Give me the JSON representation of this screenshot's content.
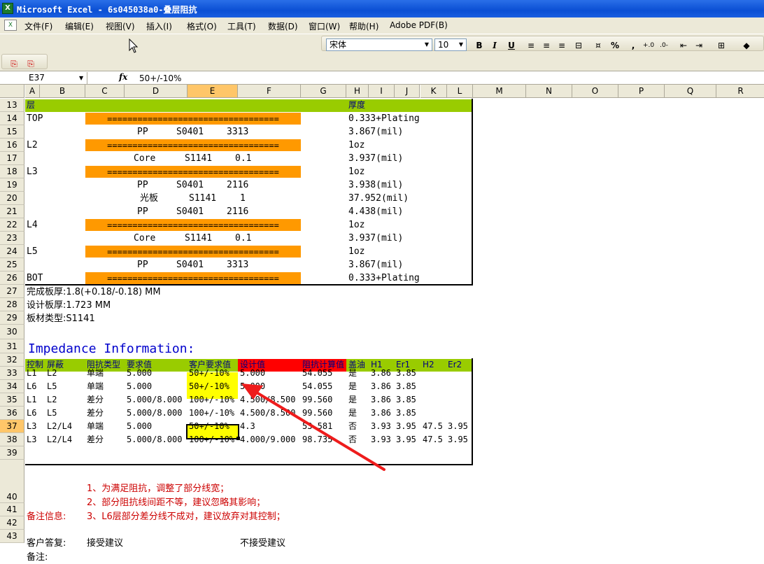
{
  "window": {
    "title": "Microsoft Excel - 6s045038a0-叠层阻抗",
    "app_icon": "excel-icon"
  },
  "menu": [
    "文件(F)",
    "编辑(E)",
    "视图(V)",
    "插入(I)",
    "格式(O)",
    "工具(T)",
    "数据(D)",
    "窗口(W)",
    "帮助(H)",
    "Adobe PDF(B)"
  ],
  "toolbar": {
    "font": "宋体",
    "size": "10",
    "bold": "B",
    "italic": "I",
    "underline": "U",
    "percent": "%",
    "comma": ","
  },
  "formula_bar": {
    "name_box": "E37",
    "fx": "fx",
    "value": "50+/-10%"
  },
  "columns": [
    "A",
    "B",
    "C",
    "D",
    "E",
    "F",
    "G",
    "H",
    "I",
    "J",
    "K",
    "L",
    "M",
    "N",
    "O",
    "P",
    "Q",
    "R"
  ],
  "selected_cell": {
    "column": "E",
    "row": "37"
  },
  "rows": [
    "13",
    "14",
    "15",
    "16",
    "17",
    "18",
    "19",
    "20",
    "21",
    "22",
    "23",
    "24",
    "25",
    "26",
    "27",
    "28",
    "29",
    "30",
    "31",
    "32",
    "33",
    "34",
    "35",
    "36",
    "37",
    "38",
    "39",
    "40",
    "41",
    "42",
    "43"
  ],
  "stackup": {
    "header": {
      "layer": "层",
      "thickness": "厚度"
    },
    "separator": "==================================",
    "r14": {
      "a": "TOP",
      "h": "0.333+Plating"
    },
    "r15": {
      "d1": "PP",
      "d2": "S0401",
      "d3": "3313",
      "h": "3.867(mil)"
    },
    "r16": {
      "a": "L2",
      "h": "1oz"
    },
    "r17": {
      "d1": "Core",
      "d2": "S1141",
      "d3": "0.1",
      "h": "3.937(mil)"
    },
    "r18": {
      "a": "L3",
      "h": "1oz"
    },
    "r19": {
      "d1": "PP",
      "d2": "S0401",
      "d3": "2116",
      "h": "3.938(mil)"
    },
    "r20": {
      "d1": "光板",
      "d2": "S1141",
      "d3": "1",
      "h": "37.952(mil)"
    },
    "r21": {
      "d1": "PP",
      "d2": "S0401",
      "d3": "2116",
      "h": "4.438(mil)"
    },
    "r22": {
      "a": "L4",
      "h": "1oz"
    },
    "r23": {
      "d1": "Core",
      "d2": "S1141",
      "d3": "0.1",
      "h": "3.937(mil)"
    },
    "r24": {
      "a": "L5",
      "h": "1oz"
    },
    "r25": {
      "d1": "PP",
      "d2": "S0401",
      "d3": "3313",
      "h": "3.867(mil)"
    },
    "r26": {
      "a": "BOT",
      "h": "0.333+Plating"
    }
  },
  "notes": {
    "r27": "完成板厚:1.8(+0.18/-0.18) MM",
    "r28": "设计板厚:1.723 MM",
    "r29": "板材类型:S1141"
  },
  "impedance": {
    "title": "Impedance Information:",
    "headers": {
      "ctrl": "控制",
      "shield": "屏蔽",
      "type": "阻抗类型",
      "req": "要求值",
      "cust": "客户要求值",
      "design": "设计值",
      "calc": "阻抗计算值",
      "oil": "盖油",
      "h1": "H1",
      "er1": "Er1",
      "h2": "H2",
      "er2": "Er2"
    },
    "rows": [
      {
        "ctrl": "L1",
        "shield": "L2",
        "type": "单端",
        "req": "5.000",
        "cust": "50+/-10%",
        "design": "5.000",
        "calc": "54.055",
        "oil": "是",
        "h1": "3.86",
        "er1": "3.85",
        "h2": "",
        "er2": ""
      },
      {
        "ctrl": "L6",
        "shield": "L5",
        "type": "单端",
        "req": "5.000",
        "cust": "50+/-10%",
        "design": "5.000",
        "calc": "54.055",
        "oil": "是",
        "h1": "3.86",
        "er1": "3.85",
        "h2": "",
        "er2": ""
      },
      {
        "ctrl": "L1",
        "shield": "L2",
        "type": "差分",
        "req": "5.000/8.000",
        "cust": "100+/-10%",
        "design": "4.500/8.500",
        "calc": "99.560",
        "oil": "是",
        "h1": "3.86",
        "er1": "3.85",
        "h2": "",
        "er2": ""
      },
      {
        "ctrl": "L6",
        "shield": "L5",
        "type": "差分",
        "req": "5.000/8.000",
        "cust": "100+/-10%",
        "design": "4.500/8.500",
        "calc": "99.560",
        "oil": "是",
        "h1": "3.86",
        "er1": "3.85",
        "h2": "",
        "er2": ""
      },
      {
        "ctrl": "L3",
        "shield": "L2/L4",
        "type": "单端",
        "req": "5.000",
        "cust": "50+/-10%",
        "design": "4.3",
        "calc": "53.581",
        "oil": "否",
        "h1": "3.93",
        "er1": "3.95",
        "h2": "47.5",
        "er2": "3.95"
      },
      {
        "ctrl": "L3",
        "shield": "L2/L4",
        "type": "差分",
        "req": "5.000/8.000",
        "cust": "100+/-10%",
        "design": "4.000/9.000",
        "calc": "98.735",
        "oil": "否",
        "h1": "3.93",
        "er1": "3.95",
        "h2": "47.5",
        "er2": "3.95"
      }
    ]
  },
  "remarks": {
    "label": "备注信息:",
    "lines": [
      "1、为满足阻抗，调整了部分线宽；",
      "2、部分阻抗线间距不等，建议忽略其影响；",
      "3、L6层部分差分线不成对，建议放弃对其控制；"
    ]
  },
  "reply": {
    "label": "客户答复:",
    "accept": "接受建议",
    "reject": "不接受建议"
  },
  "remark2": {
    "label": "备注:"
  },
  "colors": {
    "header_green": "#99cc00",
    "separator_orange": "#ff9900",
    "highlight_yellow": "#ffff00",
    "header_red": "#ff0000",
    "arrow_red": "#ee1c1c",
    "title_blue": "#0000cc",
    "remark_red": "#cc0000"
  }
}
